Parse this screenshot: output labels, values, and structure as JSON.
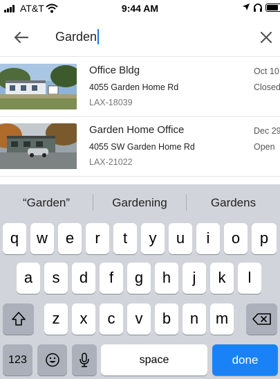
{
  "status_bar": {
    "carrier": "AT&T",
    "time": "9:44 AM",
    "battery_level": 0.85,
    "icons": [
      "signal-bars-icon",
      "wifi-icon",
      "location-arrow-icon",
      "headphones-icon",
      "battery-icon"
    ]
  },
  "search": {
    "value": "Garden",
    "back_icon": "arrow-left-icon",
    "clear_icon": "close-icon"
  },
  "results": [
    {
      "title": "Office Bldg",
      "address": "4055 Garden Home Rd",
      "id": "LAX-18039",
      "date": "Oct 10",
      "status": "Closed"
    },
    {
      "title": "Garden Home Office",
      "address": "4055 SW Garden Home Rd",
      "id": "LAX-21022",
      "date": "Dec 29",
      "status": "Open"
    }
  ],
  "keyboard": {
    "suggestions": [
      "“Garden”",
      "Gardening",
      "Gardens"
    ],
    "row1": [
      "q",
      "w",
      "e",
      "r",
      "t",
      "y",
      "u",
      "i",
      "o",
      "p"
    ],
    "row2": [
      "a",
      "s",
      "d",
      "f",
      "g",
      "h",
      "j",
      "k",
      "l"
    ],
    "row3": [
      "z",
      "x",
      "c",
      "v",
      "b",
      "n",
      "m"
    ],
    "numbers_label": "123",
    "space_label": "space",
    "done_label": "done",
    "icons": [
      "shift-icon",
      "backspace-icon",
      "emoji-icon",
      "microphone-icon"
    ],
    "accent_color": "#1a82f7"
  }
}
